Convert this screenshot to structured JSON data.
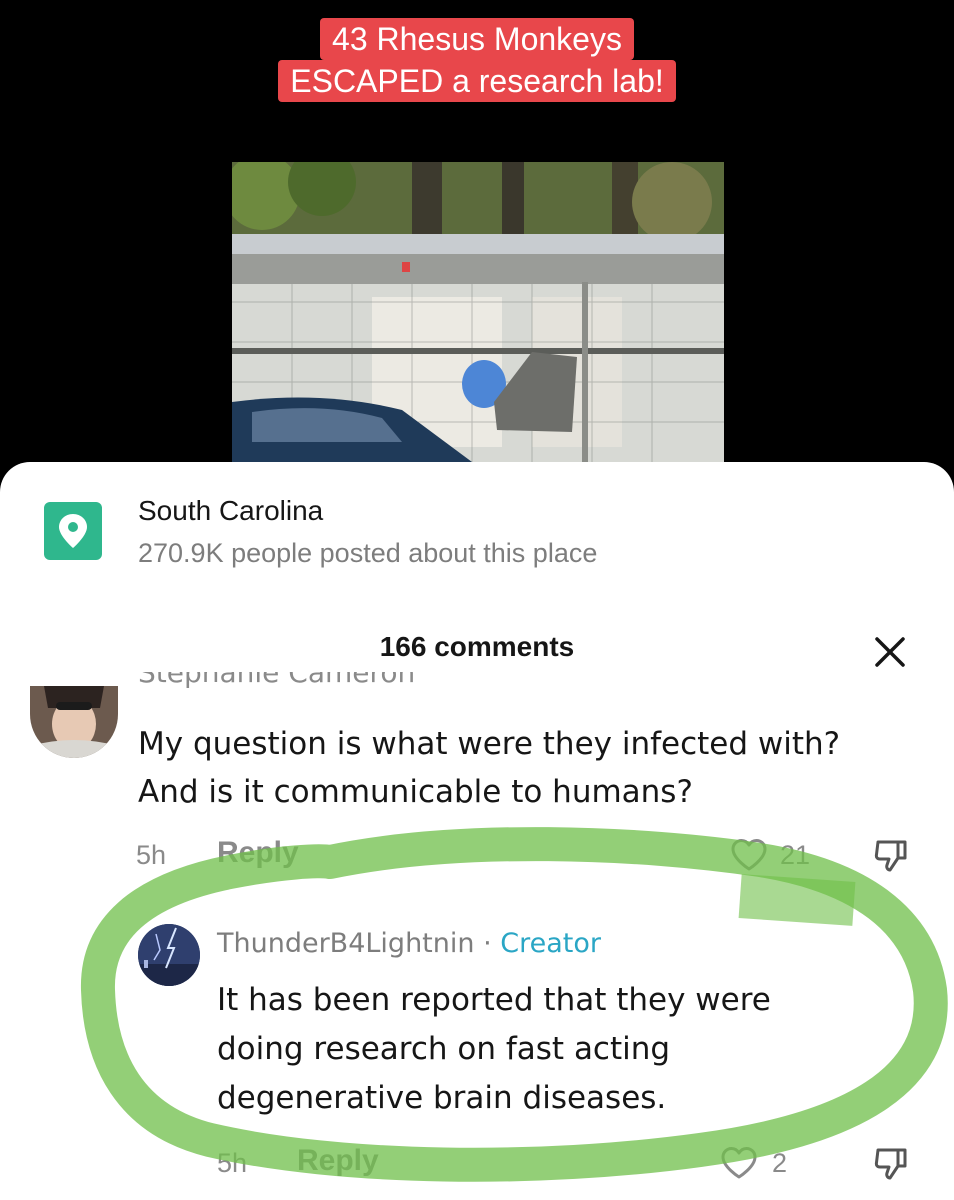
{
  "video": {
    "caption_line1": "43 Rhesus Monkeys",
    "caption_line2": "ESCAPED a research lab!",
    "caption_bg": "#e8474b"
  },
  "location": {
    "name": "South Carolina",
    "subtitle": "270.9K people posted about this place",
    "icon": "location-pin-icon",
    "icon_color": "#2fb78d"
  },
  "comments_panel": {
    "title": "166 comments",
    "close_icon": "close-icon"
  },
  "comments": [
    {
      "username_partial": "Stephanie Cameron",
      "text_line1": "My question is what were they infected with?",
      "text_line2": "And is it communicable to humans?",
      "time": "5h",
      "reply_label": "Reply",
      "likes": "21"
    },
    {
      "username": "ThunderB4Lightnin",
      "separator": " · ",
      "badge": "Creator",
      "badge_color": "#2aa6c5",
      "text_line1": "It has been reported that they were",
      "text_line2": "doing research on fast acting",
      "text_line3": "degenerative brain diseases.",
      "time": "5h",
      "reply_label": "Reply",
      "likes": "2"
    }
  ],
  "annotation": {
    "highlight_color": "#6fbf4a"
  }
}
